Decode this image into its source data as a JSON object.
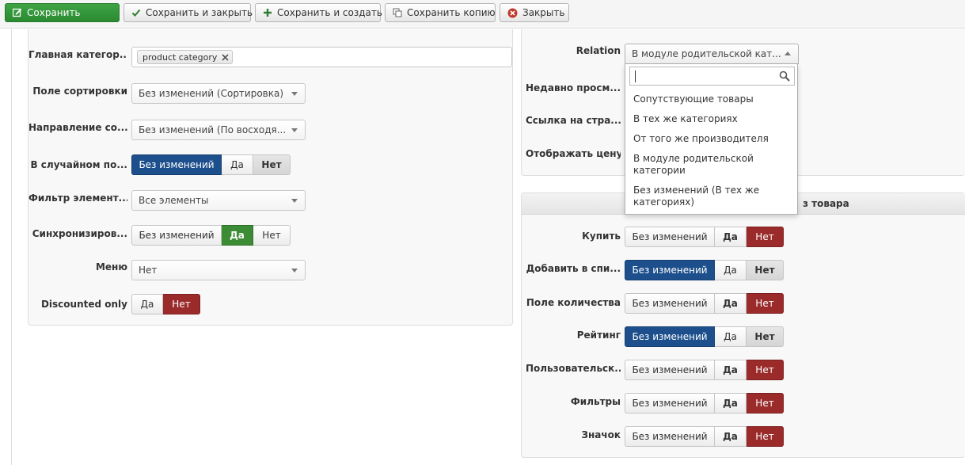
{
  "toolbar": {
    "save": "Сохранить",
    "save_close": "Сохранить и закрыть",
    "save_new": "Сохранить и создать",
    "save_copy": "Сохранить копию",
    "close": "Закрыть"
  },
  "left": {
    "main_category": {
      "label": "Главная категор...",
      "tag": "product category"
    },
    "sort_field": {
      "label": "Поле сортировки",
      "value": "Без изменений (Сортировка)"
    },
    "sort_direction": {
      "label": "Направление со...",
      "value": "Без изменений (По восходя..."
    },
    "random": {
      "label": "В случайном по...",
      "options": [
        "Без изменений",
        "Да",
        "Нет"
      ],
      "selected": "Без изменений"
    },
    "filter": {
      "label": "Фильтр элемент...",
      "value": "Все элементы"
    },
    "sync": {
      "label": "Синхронизиров...",
      "options": [
        "Без изменений",
        "Да",
        "Нет"
      ],
      "selected": "Да"
    },
    "menu": {
      "label": "Меню",
      "value": "Нет"
    },
    "discounted": {
      "label": "Discounted only",
      "options": [
        "Да",
        "Нет"
      ],
      "selected": "Нет"
    }
  },
  "right_top": {
    "relation": {
      "label": "Relation",
      "value": "В модуле родительской кат..."
    },
    "recent": {
      "label": "Недавно просм..."
    },
    "link": {
      "label": "Ссылка на стра..."
    },
    "show_price": {
      "label": "Отображать цену"
    }
  },
  "dropdown": {
    "options": [
      "Сопутствующие товары",
      "В тех же категориях",
      "От того же производителя",
      "В модуле родительской категории",
      "Без изменений (В тех же категориях)"
    ]
  },
  "right_bottom": {
    "header": "з товара",
    "rows": [
      {
        "label": "Купить",
        "selected": "Нет"
      },
      {
        "label": "Добавить в спи...",
        "selected": "Без изменений"
      },
      {
        "label": "Поле количества",
        "selected": "Нет"
      },
      {
        "label": "Рейтинг",
        "selected": "Без изменений"
      },
      {
        "label": "Пользовательск...",
        "selected": "Нет"
      },
      {
        "label": "Фильтры",
        "selected": "Нет"
      },
      {
        "label": "Значок",
        "selected": "Нет"
      }
    ],
    "options": [
      "Без изменений",
      "Да",
      "Нет"
    ]
  },
  "colors": {
    "save_green": "#2a8a31",
    "blue_active": "#1c4f8c",
    "green_active": "#3b8c34",
    "red_active": "#9b2b2b"
  }
}
